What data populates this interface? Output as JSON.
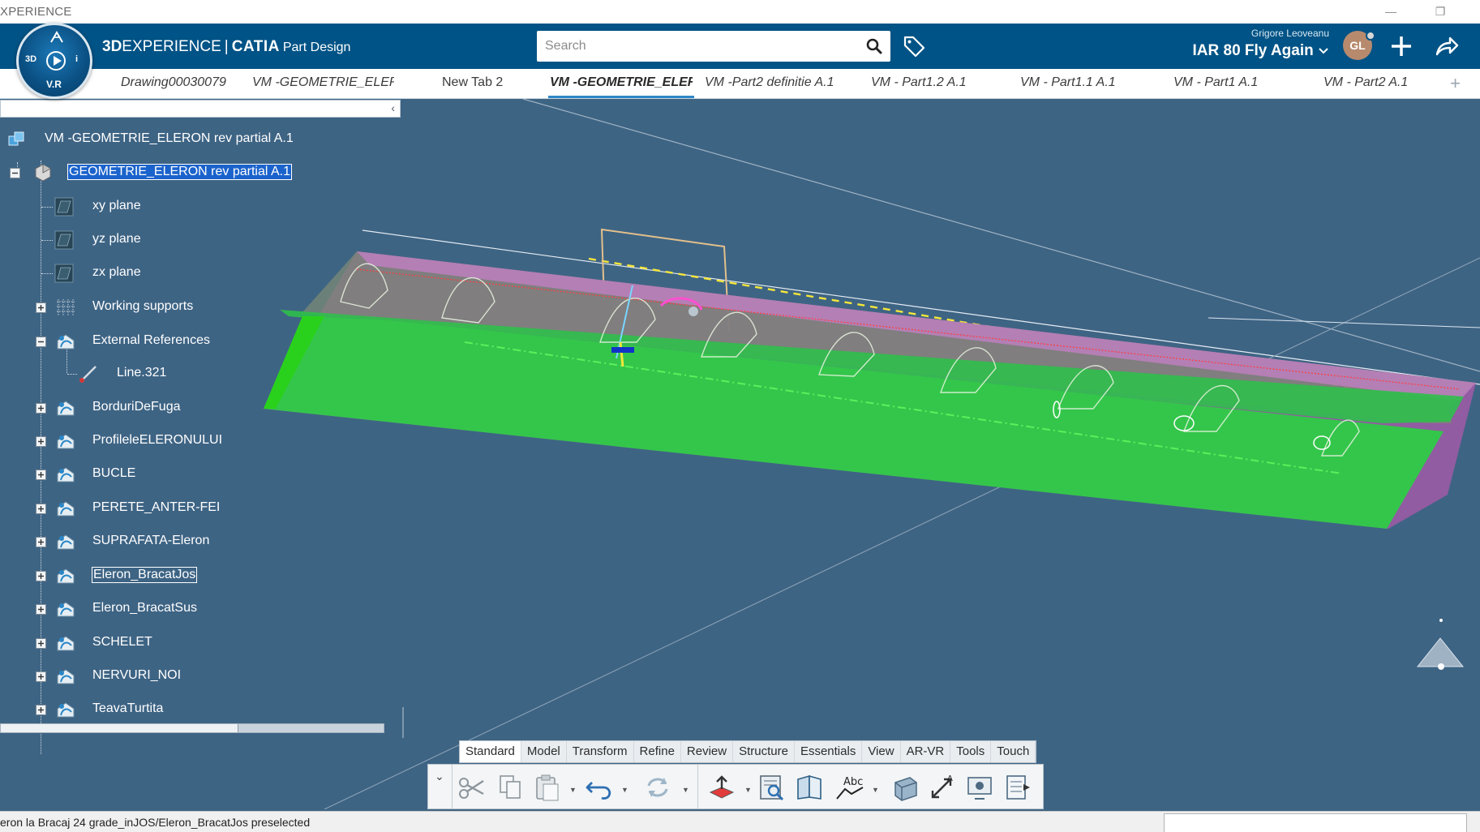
{
  "window": {
    "title": "XPERIENCE",
    "minimize": "—",
    "restore": "❐"
  },
  "header": {
    "compass_labels": {
      "top": "",
      "left": "3D",
      "right": "i",
      "bottom": "V.R"
    },
    "brand_3d": "3D",
    "brand_experience": "EXPERIENCE",
    "brand_sep": "|",
    "brand_catia": "CATIA",
    "brand_app": "Part Design",
    "search_placeholder": "Search",
    "user_name": "Grigore Leoveanu",
    "collab_space": "IAR 80 Fly Again",
    "avatar_initials": "GL",
    "colors": {
      "bar": "#005386",
      "accent": "#2f86c7"
    }
  },
  "tabs": [
    {
      "label": "Drawing00030079",
      "active": false
    },
    {
      "label": "VM -GEOMETRIE_ELERC",
      "active": false
    },
    {
      "label": "New Tab 2",
      "active": false
    },
    {
      "label": "VM -GEOMETRIE_ELER",
      "active": true
    },
    {
      "label": "VM -Part2 definitie A.1",
      "active": false
    },
    {
      "label": "VM - Part1.2 A.1",
      "active": false
    },
    {
      "label": "VM - Part1.1 A.1",
      "active": false
    },
    {
      "label": "VM - Part1 A.1",
      "active": false
    },
    {
      "label": "VM - Part2 A.1",
      "active": false
    }
  ],
  "tab_add": "+",
  "tree": {
    "collapse_glyph": "‹",
    "root": "VM -GEOMETRIE_ELERON rev partial A.1",
    "part": "GEOMETRIE_ELERON rev partial A.1",
    "items": [
      {
        "label": "xy plane",
        "icon": "plane-icon"
      },
      {
        "label": "yz plane",
        "icon": "plane-icon"
      },
      {
        "label": "zx plane",
        "icon": "plane-icon"
      },
      {
        "label": "Working supports",
        "icon": "grid-icon"
      },
      {
        "label": "External References",
        "icon": "geometrical-set-icon"
      },
      {
        "label": "Line.321",
        "icon": "line-icon"
      },
      {
        "label": "BorduriDeFuga",
        "icon": "geometrical-set-icon"
      },
      {
        "label": "ProfileleELERONULUI",
        "icon": "geometrical-set-icon"
      },
      {
        "label": "BUCLE",
        "icon": "geometrical-set-icon"
      },
      {
        "label": "PERETE_ANTER-FEI",
        "icon": "geometrical-set-icon"
      },
      {
        "label": "SUPRAFATA-Eleron",
        "icon": "geometrical-set-icon"
      },
      {
        "label": "Eleron_BracatJos",
        "icon": "geometrical-set-icon"
      },
      {
        "label": "Eleron_BracatSus",
        "icon": "geometrical-set-icon"
      },
      {
        "label": "SCHELET",
        "icon": "geometrical-set-icon"
      },
      {
        "label": "NERVURI_NOI",
        "icon": "geometrical-set-icon"
      },
      {
        "label": "TeavaTurtita",
        "icon": "geometrical-set-icon"
      }
    ]
  },
  "viewport": {
    "background": "#3e6484",
    "surface_color": "#33c24a",
    "edge_color": "#b63fa8"
  },
  "action_bar": {
    "tabs": [
      "Standard",
      "Model",
      "Transform",
      "Refine",
      "Review",
      "Structure",
      "Essentials",
      "View",
      "AR-VR",
      "Tools",
      "Touch"
    ],
    "active_tab": "Standard",
    "collapse_glyph": "⌄",
    "buttons": [
      "cut-icon",
      "copy-icon",
      "paste-icon",
      "undo-icon",
      "update-icon",
      "publish-icon",
      "search-in-model-icon",
      "book-icon",
      "annotation-icon",
      "view-icon",
      "measure-icon",
      "capture-icon",
      "export-icon"
    ]
  },
  "status": {
    "message": "eron la Bracaj 24 grade_inJOS/Eleron_BracatJos preselected"
  }
}
